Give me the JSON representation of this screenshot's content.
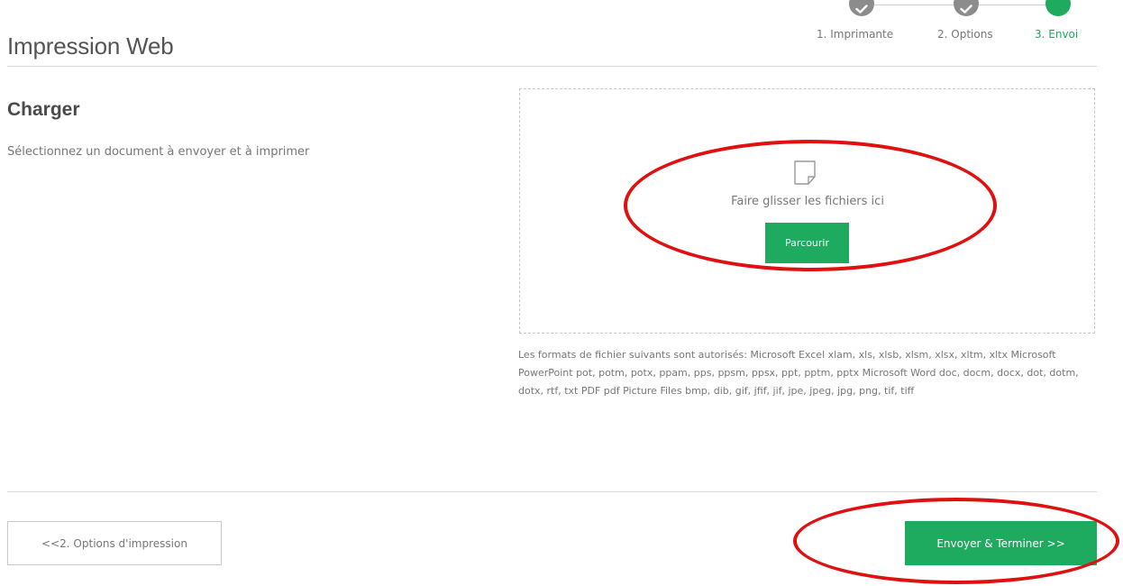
{
  "header": {
    "title": "Impression Web"
  },
  "stepper": {
    "steps": [
      {
        "label": "1. Imprimante",
        "state": "done"
      },
      {
        "label": "2. Options",
        "state": "done"
      },
      {
        "label": "3. Envoi",
        "state": "active"
      }
    ],
    "done_icon": "check-icon"
  },
  "upload": {
    "title": "Charger",
    "description": "Sélectionnez un document à envoyer et à imprimer",
    "dropzone": {
      "icon": "document-icon",
      "text": "Faire glisser les fichiers ici",
      "browse_label": "Parcourir"
    },
    "formats_text": "Les formats de fichier suivants sont autorisés: Microsoft Excel xlam, xls, xlsb, xlsm, xlsx, xltm, xltx Microsoft PowerPoint pot, potm, potx, ppam, pps, ppsm, ppsx, ppt, pptm, pptx Microsoft Word doc, docm, docx, dot, dotm, dotx, rtf, txt PDF pdf Picture Files bmp, dib, gif, jfif, jif, jpe, jpeg, jpg, png, tif, tiff"
  },
  "footer": {
    "prev_label": "<<2. Options d'impression",
    "finish_label": "Envoyer & Terminer >>"
  },
  "colors": {
    "accent": "#1eaa5f",
    "step_done": "#8c8c8c",
    "annotation": "#e01010"
  }
}
